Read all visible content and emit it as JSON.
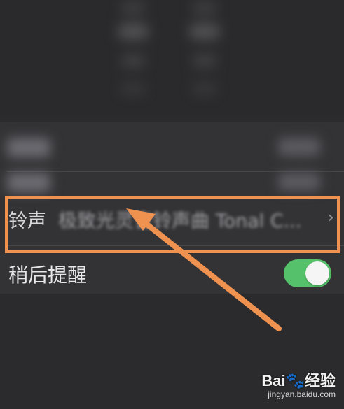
{
  "ringtone": {
    "label": "铃声",
    "value": "极致光灵音铃声曲 Tonal C...",
    "chevron": "›"
  },
  "snooze": {
    "label": "稍后提醒",
    "toggle_on": true
  },
  "colors": {
    "highlight": "#f0924f",
    "toggle": "#55c16a",
    "background": "#2b2b2d"
  },
  "watermark": {
    "logo": "Bai🐾经验",
    "url": "jingyan.baidu.com"
  }
}
